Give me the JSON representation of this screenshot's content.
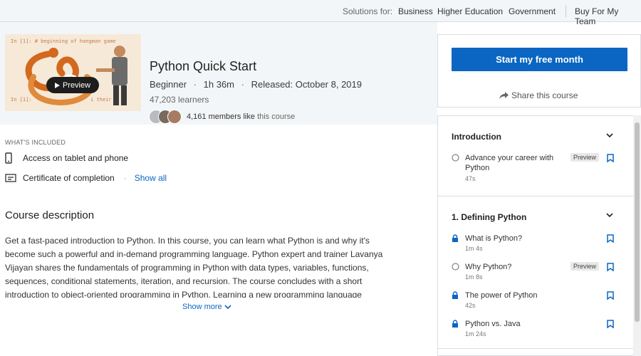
{
  "topbar": {
    "solutions_label": "Solutions for:",
    "links": [
      "Business",
      "Higher Education",
      "Government"
    ],
    "buy_label": "Buy For My Team"
  },
  "course": {
    "title": "Python Quick Start",
    "level": "Beginner",
    "duration": "1h 36m",
    "released": "Released: October 8, 2019",
    "learners": "47,203 learners",
    "members_count": "4,161 members like",
    "members_suffix": "this course",
    "preview_label": "Preview",
    "thumb_code_line": "In [1]:   # beginning of hangman game",
    "thumb_code_line2": "In [1]:",
    "thumb_code_line3": "i their"
  },
  "cta": {
    "start_label": "Start my free month",
    "share_label": "Share this course"
  },
  "included": {
    "heading": "WHAT'S INCLUDED",
    "items": [
      "Access on tablet and phone",
      "Certificate of completion"
    ],
    "show_all": "Show all"
  },
  "description": {
    "title": "Course description",
    "body": "Get a fast-paced introduction to Python. In this course, you can learn what Python is and why it's become such a powerful and in-demand programming language. Python expert and trainer Lavanya Vijayan shares the fundamentals of programming in Python with data types, variables, functions, sequences, conditional statements, iteration, and recursion. The course concludes with a short introduction to object-oriented programming in Python. Learning a new programming language",
    "show_more": "Show more"
  },
  "toc": {
    "sections": [
      {
        "title": "Introduction",
        "items": [
          {
            "title": "Advance your career with Python",
            "duration": "47s",
            "preview": "Preview",
            "locked": false
          }
        ]
      },
      {
        "title": "1. Defining Python",
        "items": [
          {
            "title": "What is Python?",
            "duration": "1m 4s",
            "locked": true
          },
          {
            "title": "Why Python?",
            "duration": "1m 8s",
            "preview": "Preview",
            "locked": false
          },
          {
            "title": "The power of Python",
            "duration": "42s",
            "locked": true
          },
          {
            "title": "Python vs. Java",
            "duration": "1m 24s",
            "locked": true
          }
        ]
      }
    ]
  },
  "colors": {
    "accent": "#0a66c2",
    "hero_bg": "#f3f6f8"
  }
}
